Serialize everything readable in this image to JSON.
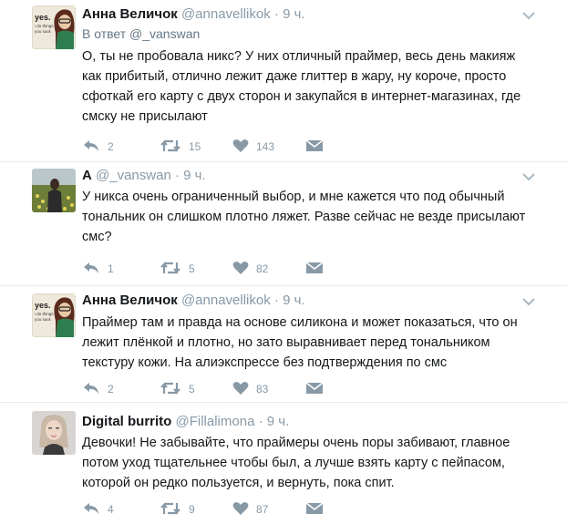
{
  "tweets": [
    {
      "name": "Анна Величок",
      "handle": "@annavellikok",
      "dot": "·",
      "time": "9 ч.",
      "reply_to": "В ответ @_vanswan",
      "text": "О, ты не пробовала никс? У них отличный праймер, весь день макияж как прибитый, отлично лежит даже глиттер в жару, ну короче, просто сфоткай его карту с двух сторон и закупайся в интернет-магазинах, где смску не присылают",
      "replies": "2",
      "retweets": "15",
      "likes": "143",
      "avatar_lines": [
        "yes.",
        "i do things",
        "you suck"
      ]
    },
    {
      "name": "А",
      "handle": "@_vanswan",
      "dot": "·",
      "time": "9 ч.",
      "text": "У никса очень ограниченный выбор, и мне кажется что под обычный тональник он слишком плотно ляжет. Разве сейчас не везде присылают смс?",
      "replies": "1",
      "retweets": "5",
      "likes": "82"
    },
    {
      "name": "Анна Величок",
      "handle": "@annavellikok",
      "dot": "·",
      "time": "9 ч.",
      "text": "Праймер там и правда на основе силикона и может показаться, что он лежит плёнкой и плотно, но зато выравнивает перед тональником текстуру кожи. На алиэкспрессе без подтверждения по смс",
      "replies": "2",
      "retweets": "5",
      "likes": "83",
      "avatar_lines": [
        "yes.",
        "i do things",
        "you suck"
      ]
    },
    {
      "name": "Digital burrito",
      "handle": "@Fillalimona",
      "dot": "·",
      "time": "9 ч.",
      "text": "Девочки! Не забывайте, что праймеры очень поры забивают, главное потом уход тщательнее чтобы был, а лучше взять карту с пейпасом, которой он редко пользуется, и вернуть, пока спит.",
      "replies": "4",
      "retweets": "9",
      "likes": "87"
    }
  ],
  "colors": {
    "text": "#14171a",
    "muted": "#8899a6",
    "icon": "#8899a6",
    "divider": "#e6ecf0"
  },
  "icons": [
    "reply-icon",
    "retweet-icon",
    "heart-icon",
    "message-icon",
    "chevron-down-icon"
  ]
}
